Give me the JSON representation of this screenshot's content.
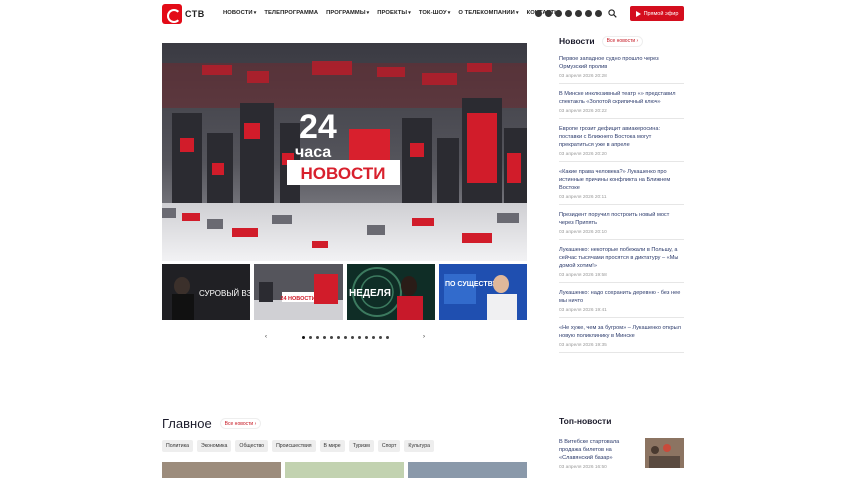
{
  "logo": {
    "text": "СТВ"
  },
  "nav": [
    {
      "label": "НОВОСТИ",
      "has_dropdown": true
    },
    {
      "label": "ТЕЛЕПРОГРАММА",
      "has_dropdown": false
    },
    {
      "label": "ПРОГРАММЫ",
      "has_dropdown": true
    },
    {
      "label": "ПРОЕКТЫ",
      "has_dropdown": true
    },
    {
      "label": "ТОК-ШОУ",
      "has_dropdown": true
    },
    {
      "label": "О ТЕЛЕКОМПАНИИ",
      "has_dropdown": true
    },
    {
      "label": "КОНТАКТЫ",
      "has_dropdown": false
    }
  ],
  "socials": [
    "vk-icon",
    "tiktok-icon",
    "telegram-icon",
    "odnoklassniki-icon",
    "viber-icon",
    "youtube-icon",
    "instagram-icon"
  ],
  "live_button": {
    "label": "Прямой эфир"
  },
  "hero": {
    "line1": "24",
    "line2": "часа",
    "line3": "НОВОСТИ"
  },
  "thumbs": [
    {
      "title": "СУРОВЫЙ ВЗГЛЯД",
      "active": false
    },
    {
      "title": "24 НОВОСТИ",
      "active": true
    },
    {
      "title": "НЕДЕЛЯ",
      "active": false
    },
    {
      "title": "ПО СУЩЕСТВУ",
      "active": false
    }
  ],
  "carousel": {
    "dot_count": 13,
    "prev": "‹",
    "next": "›"
  },
  "news": {
    "title": "Новости",
    "all_label": "Все новости",
    "items": [
      {
        "text": "Первое западное судно прошло через Ормузский пролив",
        "date": "03 апреля 2026 20:28"
      },
      {
        "text": "В Минске инклюзивный театр «» представил спектакль «Золотой скрипичный ключ»",
        "date": "03 апреля 2026 20:22"
      },
      {
        "text": "Европе грозит дефицит авиакеросина: поставки с Ближнего Востока могут прекратиться уже в апреле",
        "date": "03 апреля 2026 20:20"
      },
      {
        "text": "«Какие права человека?» Лукашенко про истинные причины конфликта на Ближнем Востоке",
        "date": "03 апреля 2026 20:11"
      },
      {
        "text": "Президент поручил построить новый мост через Припять",
        "date": "03 апреля 2026 20:10"
      },
      {
        "text": "Лукашенко: некоторые побежали в Польшу, а сейчас тысячами просятся в диктатуру – «Мы домой хотим!»",
        "date": "03 апреля 2026 19:58"
      },
      {
        "text": "Лукашенко: надо сохранить деревню - без нее мы ничто",
        "date": "03 апреля 2026 19:41"
      },
      {
        "text": "«Не хуже, чем за бугром» – Лукашенко открыл новую поликлинику в Минске",
        "date": "03 апреля 2026 19:35"
      }
    ]
  },
  "main": {
    "title": "Главное",
    "all_label": "Все новости",
    "categories": [
      "Политика",
      "Экономика",
      "Общество",
      "Происшествия",
      "В мире",
      "Туризм",
      "Спорт",
      "Культура"
    ]
  },
  "top_news": {
    "title": "Топ-новости",
    "items": [
      {
        "text": "В Витебске стартовала продажа билетов на «Славянский базар»",
        "date": "03 апреля 2026 16:50"
      }
    ]
  },
  "colors": {
    "accent": "#d40e1e",
    "link": "#2b3a6b",
    "date": "#9a9a9a"
  }
}
